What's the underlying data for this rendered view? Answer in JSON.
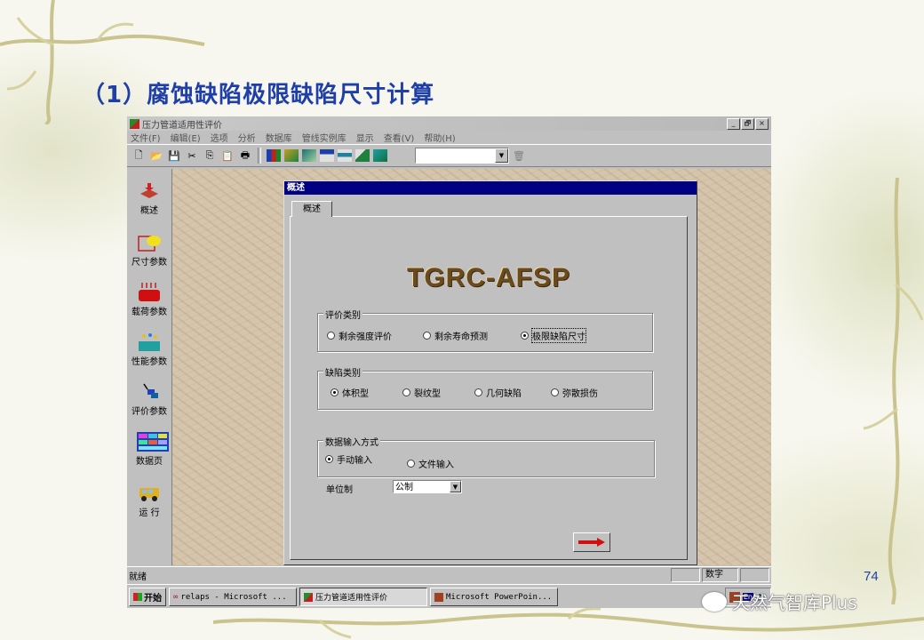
{
  "slide": {
    "title": "（1）腐蚀缺陷极限缺陷尺寸计算",
    "page_number": "74",
    "watermark": "天然气智库Plus"
  },
  "window": {
    "title": "压力管道适用性评价",
    "controls": [
      "_",
      "🗗",
      "×"
    ]
  },
  "menu": [
    "文件(F)",
    "编辑(E)",
    "选项",
    "分析",
    "数据库",
    "管线实例库",
    "显示",
    "查看(V)",
    "帮助(H)"
  ],
  "sidebar": [
    {
      "label": "概述",
      "icon": "overview-icon"
    },
    {
      "label": "尺寸参数",
      "icon": "dimension-icon"
    },
    {
      "label": "载荷参数",
      "icon": "load-icon"
    },
    {
      "label": "性能参数",
      "icon": "performance-icon"
    },
    {
      "label": "评价参数",
      "icon": "evaluation-icon"
    },
    {
      "label": "数据页",
      "icon": "data-sheet-icon"
    },
    {
      "label": "运  行",
      "icon": "run-icon"
    }
  ],
  "dialog": {
    "title": "概述",
    "tab": "概述",
    "brand": "TGRC-AFSP",
    "eval_group": {
      "legend": "评价类别",
      "options": [
        "剩余强度评价",
        "剩余寿命预测",
        "极限缺陷尺寸"
      ],
      "selected": 2
    },
    "defect_group": {
      "legend": "缺陷类别",
      "options": [
        "体积型",
        "裂纹型",
        "几何缺陷",
        "弥散损伤"
      ],
      "selected": 0
    },
    "input_group": {
      "legend": "数据输入方式",
      "options": [
        "手动输入",
        "文件输入"
      ],
      "selected": 0
    },
    "unit_label": "单位制",
    "unit_value": "公制"
  },
  "status": {
    "left": "就绪",
    "cells": [
      "",
      "数字",
      ""
    ]
  },
  "taskbar": {
    "start": "开始",
    "tasks": [
      {
        "label": "relaps - Microsoft ...",
        "active": false
      },
      {
        "label": "压力管道适用性评价",
        "active": true
      },
      {
        "label": "Microsoft PowerPoin...",
        "active": false
      }
    ],
    "tray_text": "En"
  },
  "colors": {
    "title_blue": "#1f3fa8",
    "dialog_title": "#000080",
    "win_gray": "#c0c0c0"
  }
}
